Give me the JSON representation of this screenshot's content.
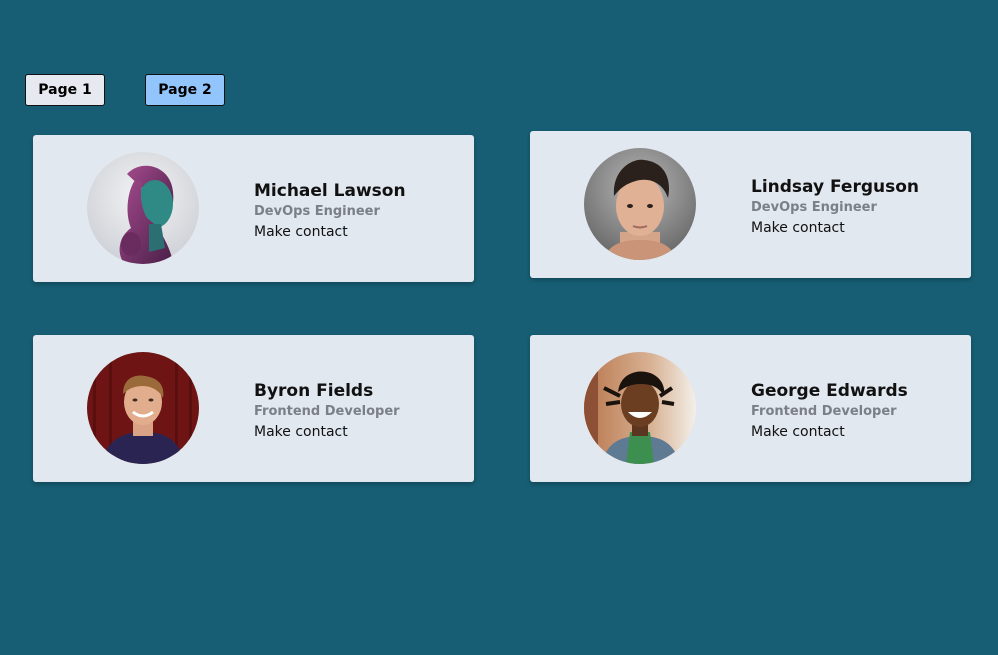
{
  "pagination": {
    "page1_label": "Page 1",
    "page2_label": "Page 2",
    "active_page": "Page 2"
  },
  "colors": {
    "background": "#175e74",
    "card": "#e2e8f0",
    "active_button": "#93c5fd",
    "inactive_button": "#e6e9ef",
    "role_text": "#7b7f86"
  },
  "profiles": [
    {
      "name": "Michael Lawson",
      "role": "DevOps Engineer",
      "contact_label": "Make contact",
      "avatar": "portrait-woman-purple-teal"
    },
    {
      "name": "Lindsay Ferguson",
      "role": "DevOps Engineer",
      "contact_label": "Make contact",
      "avatar": "portrait-young-man-gray"
    },
    {
      "name": "Byron Fields",
      "role": "Frontend Developer",
      "contact_label": "Make contact",
      "avatar": "portrait-smiling-man-red-wall"
    },
    {
      "name": "George Edwards",
      "role": "Frontend Developer",
      "contact_label": "Make contact",
      "avatar": "portrait-laughing-man-street"
    }
  ]
}
